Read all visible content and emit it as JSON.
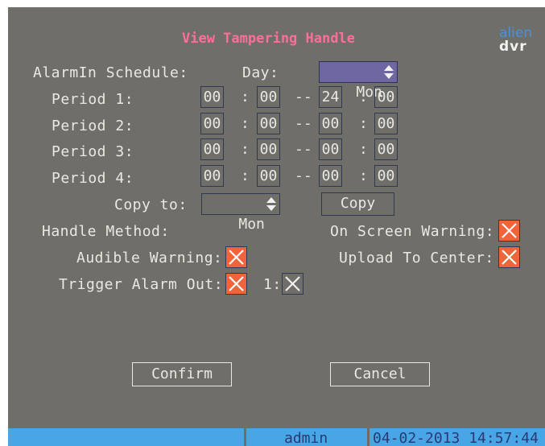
{
  "title": "View Tampering Handle",
  "logo": {
    "line1": "alien",
    "line2": "dvr"
  },
  "labels": {
    "alarmin_schedule": "AlarmIn Schedule:",
    "day": "Day:",
    "period1": "Period 1:",
    "period2": "Period 2:",
    "period3": "Period 3:",
    "period4": "Period 4:",
    "copy_to": "Copy to:",
    "handle_method": "Handle Method:",
    "on_screen_warning": "On Screen Warning:",
    "audible_warning": "Audible Warning:",
    "upload_to_center": "Upload To Center:",
    "trigger_alarm_out": "Trigger Alarm Out:",
    "alarm_out_1": "1:"
  },
  "separators": {
    "colon": ":",
    "dash": "--"
  },
  "day_value": "Mon",
  "periods": [
    {
      "start_h": "00",
      "start_m": "00",
      "end_h": "24",
      "end_m": "00"
    },
    {
      "start_h": "00",
      "start_m": "00",
      "end_h": "00",
      "end_m": "00"
    },
    {
      "start_h": "00",
      "start_m": "00",
      "end_h": "00",
      "end_m": "00"
    },
    {
      "start_h": "00",
      "start_m": "00",
      "end_h": "00",
      "end_m": "00"
    }
  ],
  "copy_to_value": "Mon",
  "copy_button": "Copy",
  "checkboxes": {
    "on_screen_warning": true,
    "audible_warning": true,
    "upload_to_center": true,
    "trigger_alarm_out": true,
    "alarm_out_1": false
  },
  "confirm_button": "Confirm",
  "cancel_button": "Cancel",
  "status": {
    "user": "admin",
    "datetime": "04-02-2013 14:57:44"
  },
  "colors": {
    "background": "#6f6e68",
    "title": "#ff6f99",
    "checkbox_on": "#f0643c",
    "status_bar": "#48a6e6"
  }
}
